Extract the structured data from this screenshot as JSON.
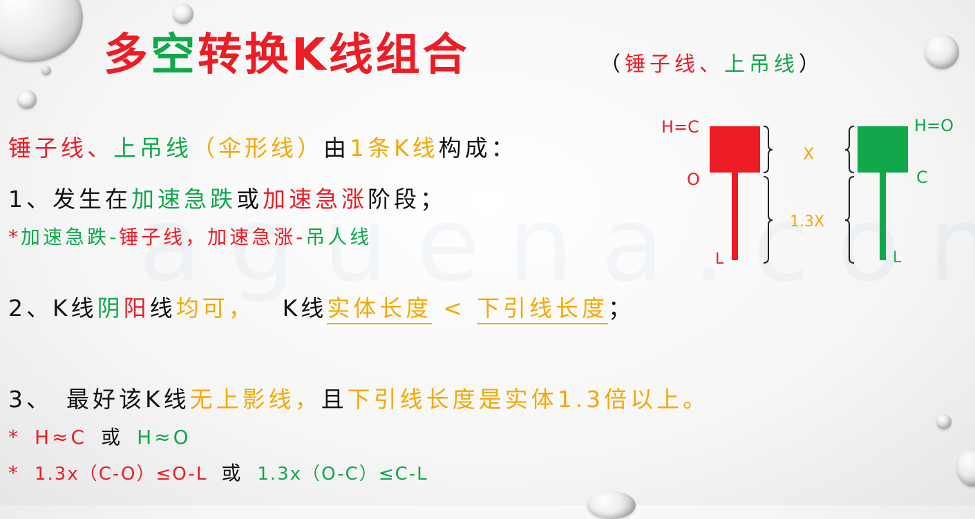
{
  "title": {
    "p1": "多",
    "p2": "空",
    "p3": "转换K线组合",
    "sub_open": "（",
    "sub_red": "锤子线、",
    "sub_green": "上吊线",
    "sub_close": "）"
  },
  "intro": {
    "red": "锤子线、",
    "green": "上吊线",
    "yellow": "（伞形线）",
    "black1": "由",
    "yellow2": "1条K线",
    "black2": "构成："
  },
  "item1": {
    "num": "1、",
    "black1": "发生在",
    "green": "加速急跌",
    "black2": "或",
    "red": "加速急涨",
    "black3": "阶段；"
  },
  "item1_note": {
    "star": "*",
    "green1": "加速急跌-",
    "red1": "锤子线，",
    "red2": "加速急涨-",
    "green2": "吊人线"
  },
  "item2": {
    "num": "2、",
    "black1": "K线",
    "green": "阴",
    "red": "阳",
    "black2": "线",
    "yellow1": "均可，",
    "black3": "K线",
    "yellow2": "实体长度",
    "yellow3": "<",
    "yellow4": "下引线长度",
    "black4": "；"
  },
  "item3": {
    "num": "3、",
    "black1": "最好该K线",
    "yellow1": "无上影线，",
    "black2": "且",
    "yellow2": "下引线长度是实体1.3倍以上。"
  },
  "cond1": {
    "star": "*",
    "red": "H≈C",
    "black": "或",
    "green": "H≈O"
  },
  "cond2": {
    "star": "*",
    "red": "1.3x（C-O）≤O-L",
    "black": "或",
    "green": "1.3x（O-C）≤C-L"
  },
  "diagram": {
    "red_top": "H=C",
    "red_open": "O",
    "red_low": "L",
    "x_label": "X",
    "ratio_label": "1.3X",
    "green_top": "H=O",
    "green_close": "C",
    "green_low": "L"
  },
  "watermark": "aguena.com",
  "colors": {
    "red": "#ee1c25",
    "green": "#10a84a",
    "yellow": "#f5a800",
    "black": "#111111"
  }
}
